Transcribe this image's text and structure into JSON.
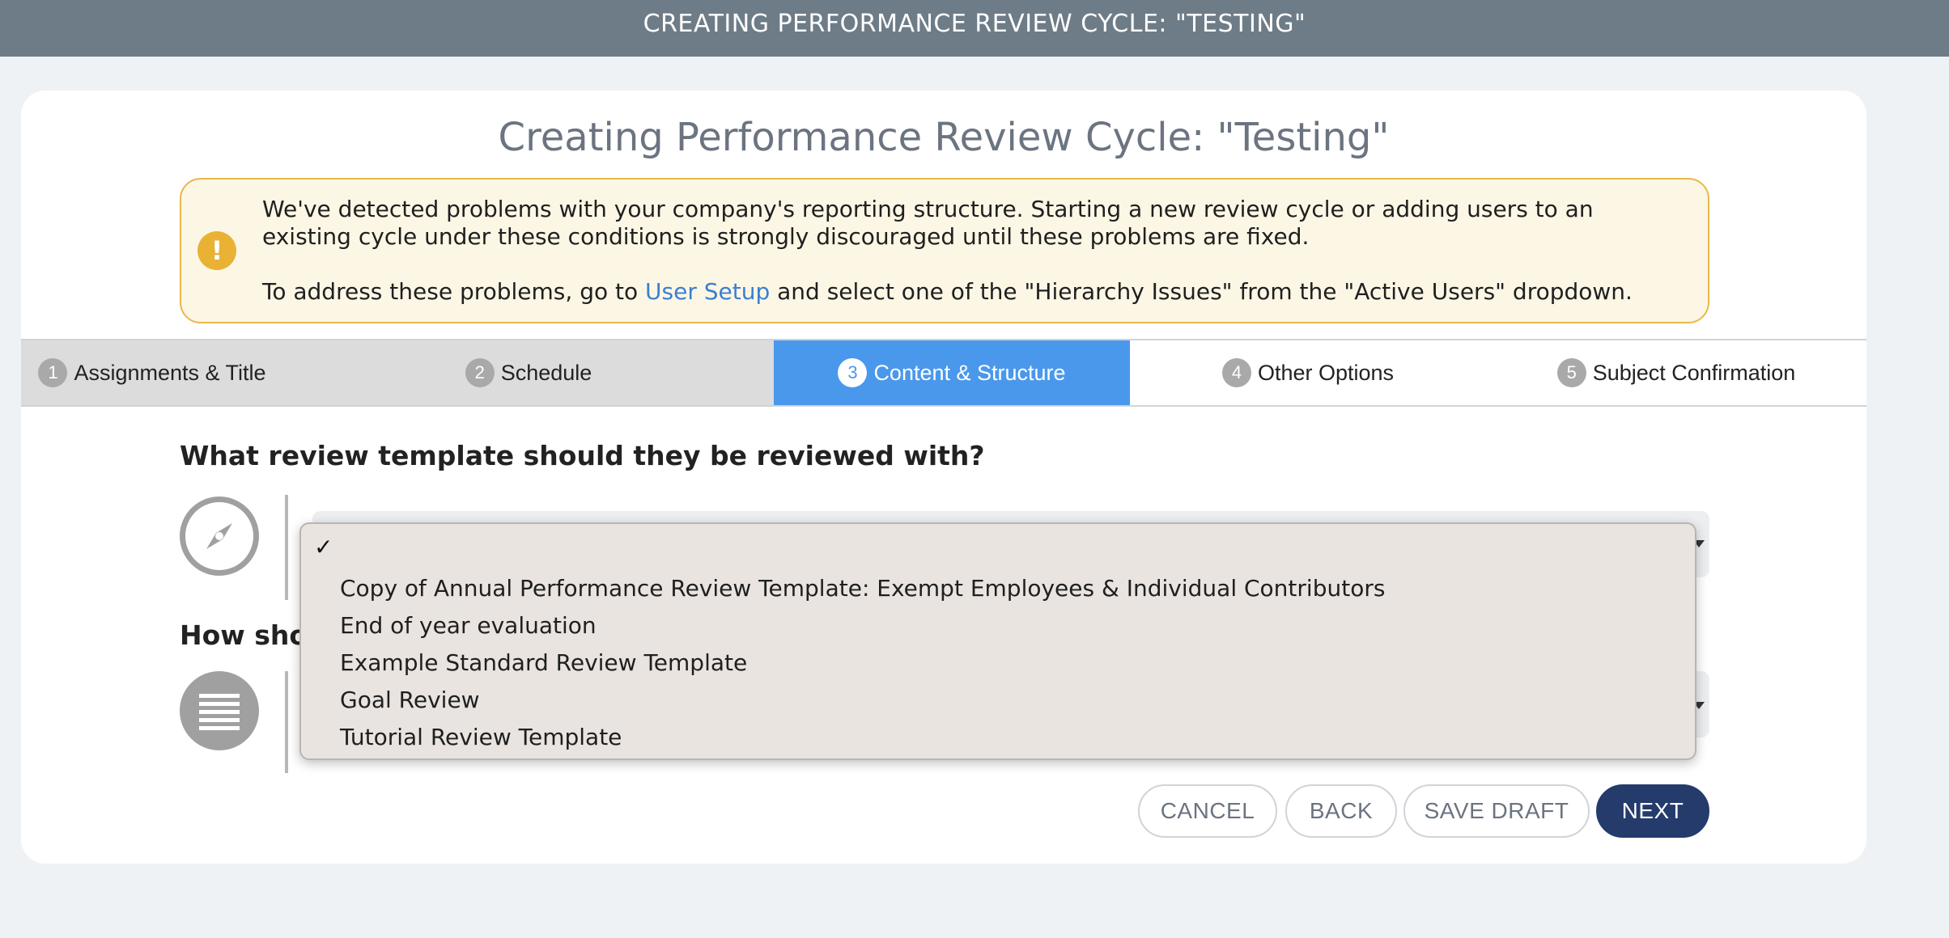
{
  "window": {
    "title": "CREATING PERFORMANCE REVIEW CYCLE: \"TESTING\""
  },
  "page": {
    "title": "Creating Performance Review Cycle: \"Testing\""
  },
  "warning": {
    "icon": "exclamation-icon",
    "message": "We've detected problems with your company's reporting structure. Starting a new review cycle or adding users to an existing cycle under these conditions is strongly discouraged until these problems are fixed.",
    "fix_prefix": "To address these problems, go to ",
    "fix_link": "User Setup",
    "fix_suffix": " and select one of the \"Hierarchy Issues\" from the \"Active Users\" dropdown.",
    "colors": {
      "background": "#fcf6e5",
      "border": "#e8b84a",
      "icon": "#e9b235"
    }
  },
  "steps": [
    {
      "num": "1",
      "label": "Assignments & Title",
      "state": "done"
    },
    {
      "num": "2",
      "label": "Schedule",
      "state": "done"
    },
    {
      "num": "3",
      "label": "Content & Structure",
      "state": "active"
    },
    {
      "num": "4",
      "label": "Other Options",
      "state": "upcoming"
    },
    {
      "num": "5",
      "label": "Subject Confirmation",
      "state": "upcoming"
    }
  ],
  "accent_color": "#4a98ec",
  "questions": {
    "template": {
      "label": "What review template should they be reviewed with?",
      "icon": "compass-icon"
    },
    "structure": {
      "label_visible": "How shou",
      "icon": "list-lines-icon"
    }
  },
  "dropdown": {
    "selected_mark": "✓",
    "options": [
      "Copy of Annual Performance Review Template: Exempt Employees & Individual Contributors",
      "End of year evaluation",
      "Example Standard Review Template",
      "Goal Review",
      "Tutorial Review Template"
    ]
  },
  "buttons": {
    "cancel": "CANCEL",
    "back": "BACK",
    "save_draft": "SAVE DRAFT",
    "next": "NEXT",
    "primary_color": "#243b6b"
  }
}
